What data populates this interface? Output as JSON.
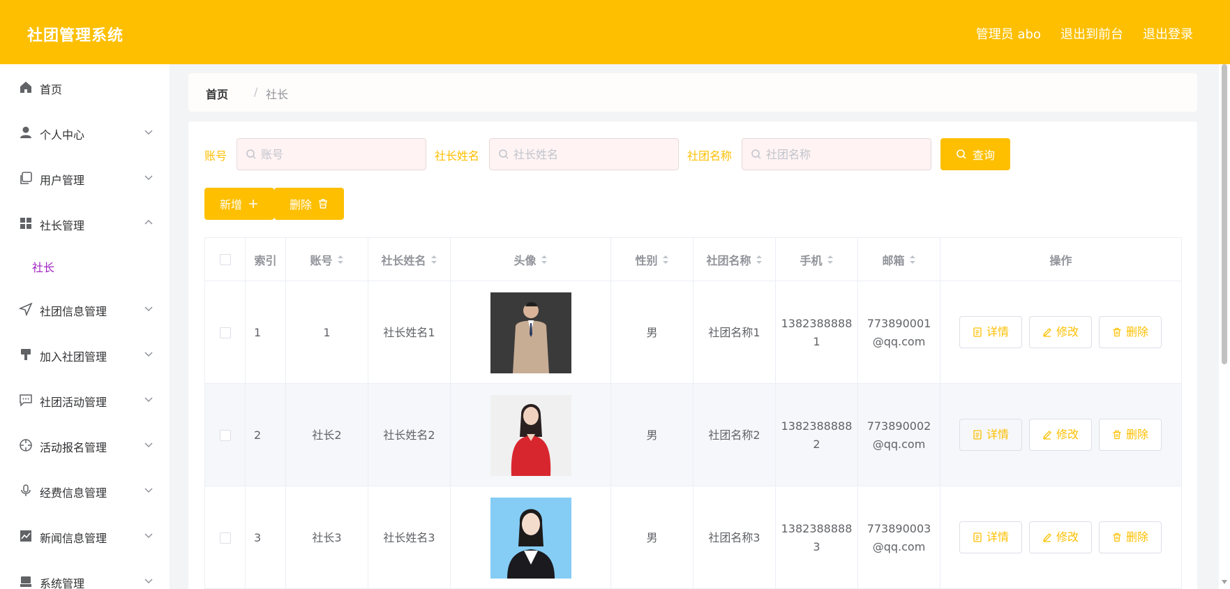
{
  "app": {
    "title": "社团管理系统"
  },
  "header": {
    "user_label": "管理员 abo",
    "exit_frontend": "退出到前台",
    "logout": "退出登录"
  },
  "sidebar": {
    "items": [
      {
        "label": "首页",
        "icon": "home-icon"
      },
      {
        "label": "个人中心",
        "icon": "user-icon"
      },
      {
        "label": "用户管理",
        "icon": "copy-icon"
      },
      {
        "label": "社长管理",
        "icon": "grid-icon"
      },
      {
        "label": "社团信息管理",
        "icon": "send-icon"
      },
      {
        "label": "加入社团管理",
        "icon": "brush-icon"
      },
      {
        "label": "社团活动管理",
        "icon": "chat-icon"
      },
      {
        "label": "活动报名管理",
        "icon": "crosshair-icon"
      },
      {
        "label": "经费信息管理",
        "icon": "microphone-icon"
      },
      {
        "label": "新闻信息管理",
        "icon": "chart-icon"
      },
      {
        "label": "系统管理",
        "icon": "box-icon"
      }
    ],
    "sub_item": "社长"
  },
  "breadcrumb": {
    "home": "首页",
    "separator": "/",
    "current": "社长"
  },
  "search": {
    "account_label": "账号",
    "account_placeholder": "账号",
    "president_label": "社长姓名",
    "president_placeholder": "社长姓名",
    "club_label": "社团名称",
    "club_placeholder": "社团名称",
    "query_button": "查询"
  },
  "toolbar": {
    "add_label": "新增",
    "delete_label": "删除"
  },
  "table": {
    "headers": {
      "index": "索引",
      "account": "账号",
      "name": "社长姓名",
      "avatar": "头像",
      "gender": "性别",
      "club": "社团名称",
      "phone": "手机",
      "email": "邮箱",
      "actions": "操作"
    },
    "rows": [
      {
        "index": "1",
        "account": "1",
        "name": "社长姓名1",
        "gender": "男",
        "club": "社团名称1",
        "phone_a": "1382388888",
        "phone_b": "1",
        "email_a": "773890001",
        "email_b": "@qq.com",
        "avatar": "man-in-suit"
      },
      {
        "index": "2",
        "account": "社长2",
        "name": "社长姓名2",
        "gender": "男",
        "club": "社团名称2",
        "phone_a": "1382388888",
        "phone_b": "2",
        "email_a": "773890002",
        "email_b": "@qq.com",
        "avatar": "woman-red-top"
      },
      {
        "index": "3",
        "account": "社长3",
        "name": "社长姓名3",
        "gender": "男",
        "club": "社团名称3",
        "phone_a": "1382388888",
        "phone_b": "3",
        "email_a": "773890003",
        "email_b": "@qq.com",
        "avatar": "woman-blue-bg"
      }
    ],
    "actions": {
      "detail": "详情",
      "edit": "修改",
      "delete": "删除"
    }
  },
  "colors": {
    "accent": "#fdbf00",
    "active_sub": "#a020c0"
  }
}
